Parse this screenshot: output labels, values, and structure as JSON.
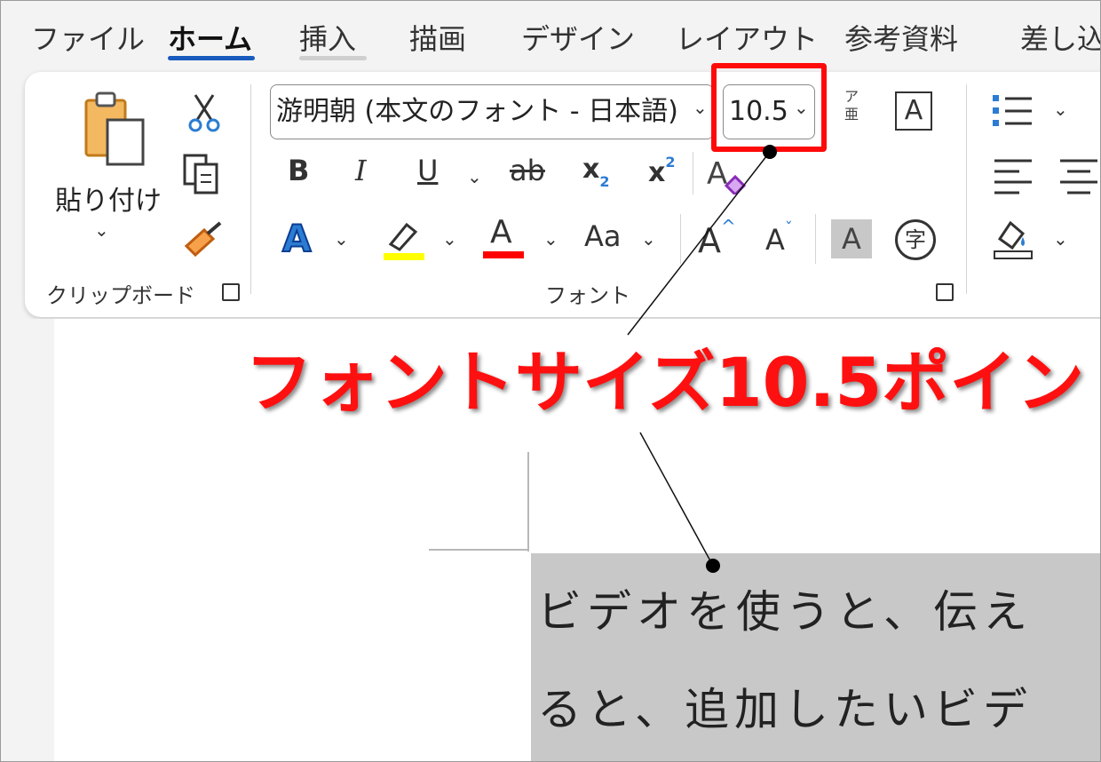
{
  "tabs": [
    {
      "label": "ファイル",
      "active": false
    },
    {
      "label": "ホーム",
      "active": true
    },
    {
      "label": "挿入",
      "active": false
    },
    {
      "label": "描画",
      "active": false
    },
    {
      "label": "デザイン",
      "active": false
    },
    {
      "label": "レイアウト",
      "active": false
    },
    {
      "label": "参考資料",
      "active": false
    },
    {
      "label": "差し込",
      "active": false
    }
  ],
  "clipboard": {
    "paste_label": "貼り付け",
    "group_label": "クリップボード",
    "icons": [
      "paste-icon",
      "cut-icon",
      "copy-icon",
      "format-painter-icon"
    ]
  },
  "font": {
    "font_name": "游明朝 (本文のフォント - 日本語)",
    "font_size": "10.5",
    "group_label": "フォント",
    "bold": "B",
    "italic": "I",
    "underline": "U",
    "strike": "ab",
    "subscript": "x",
    "subscript_mark": "2",
    "superscript": "x",
    "superscript_mark": "2",
    "case": "Aa",
    "grow": "A",
    "shrink": "A",
    "shading": "A",
    "enclose": "字",
    "highlight_color": "#ffff00",
    "font_color": "#ff0000"
  },
  "callout": {
    "text": "フォントサイズ10.5ポイント",
    "color": "#ff1010"
  },
  "document": {
    "line1": "ビデオを使うと、伝え",
    "line2": "ると、追加したいビデ"
  },
  "colors": {
    "accent": "#185abd",
    "highlight_bg": "#c8c8c8",
    "annotation": "#ff0a0a"
  }
}
